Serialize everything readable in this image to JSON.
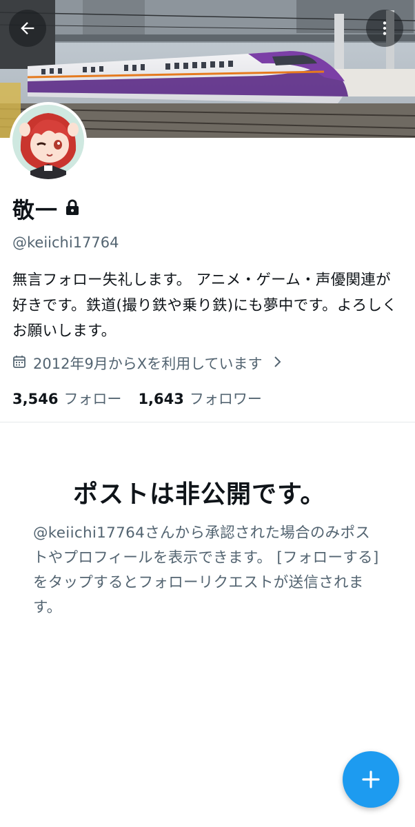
{
  "header": {
    "back_icon": "arrow-left-icon",
    "more_icon": "more-vertical-icon",
    "banner_image": "shinkansen-train-at-platform"
  },
  "profile": {
    "avatar_image": "anime-girl-red-hair-winking",
    "display_name": "敬一",
    "lock_icon": "lock-icon",
    "handle": "@keiichi17764",
    "bio": "無言フォロー失礼します。 アニメ・ゲーム・声優関連が好きです。鉄道(撮り鉄や乗り鉄)にも夢中です。よろしくお願いします。",
    "joined_icon": "calendar-icon",
    "joined": "2012年9月からXを利用しています",
    "following_count": "3,546",
    "following_label": "フォロー",
    "followers_count": "1,643",
    "followers_label": "フォロワー"
  },
  "protected": {
    "title": "ポストは非公開です。",
    "body": "@keiichi17764さんから承認された場合のみポストやプロフィールを表示できます。 [フォローする] をタップするとフォローリクエストが送信されます。"
  },
  "fab": {
    "icon": "plus-icon"
  },
  "colors": {
    "accent": "#1d9bf0",
    "text_primary": "#0f1419",
    "text_secondary": "#536471",
    "divider": "#e4e8eb"
  }
}
